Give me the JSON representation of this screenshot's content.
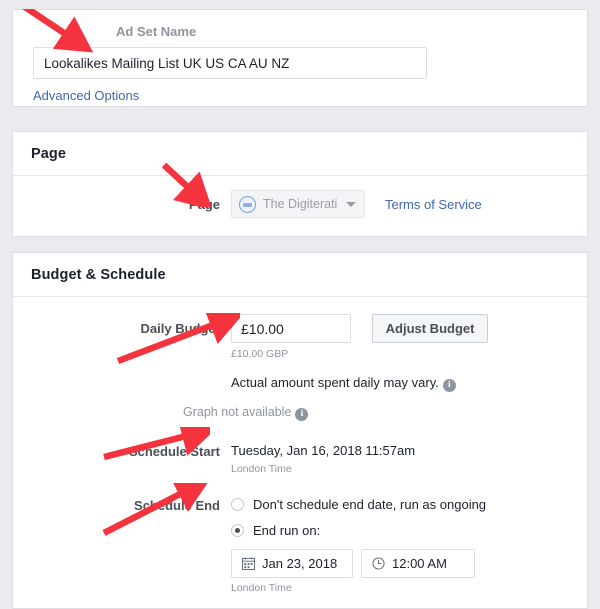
{
  "adset": {
    "label": "Ad Set Name",
    "name_value": "Lookalikes Mailing List UK US CA AU NZ",
    "name_placeholder": "Ad Set Name",
    "advanced_options": "Advanced Options"
  },
  "page_section": {
    "title": "Page",
    "field_label": "Page",
    "selected_page": "The Digiterati",
    "terms_link": "Terms of Service"
  },
  "budget": {
    "title": "Budget & Schedule",
    "daily_budget_label": "Daily Budget",
    "daily_budget_value": "£10.00",
    "daily_budget_placeholder": "£10.00",
    "adjust_button": "Adjust Budget",
    "currency_note": "£10.00 GBP",
    "spend_note": "Actual amount spent daily may vary.",
    "graph_note": "Graph not available",
    "info_glyph": "i"
  },
  "schedule": {
    "start_label": "Schedule Start",
    "start_value": "Tuesday, Jan 16, 2018 11:57am",
    "start_timezone": "London Time",
    "end_label": "Schedule End",
    "option_ongoing": "Don't schedule end date, run as ongoing",
    "option_end_on": "End run on:",
    "end_date": "Jan 23, 2018",
    "end_time": "12:00 AM",
    "end_timezone": "London Time"
  },
  "colors": {
    "background": "#e9ebee",
    "panel": "#ffffff",
    "link": "#4267b2",
    "label": "#4b4f56",
    "muted": "#90949c",
    "annotation_arrow": "#f5333f"
  }
}
